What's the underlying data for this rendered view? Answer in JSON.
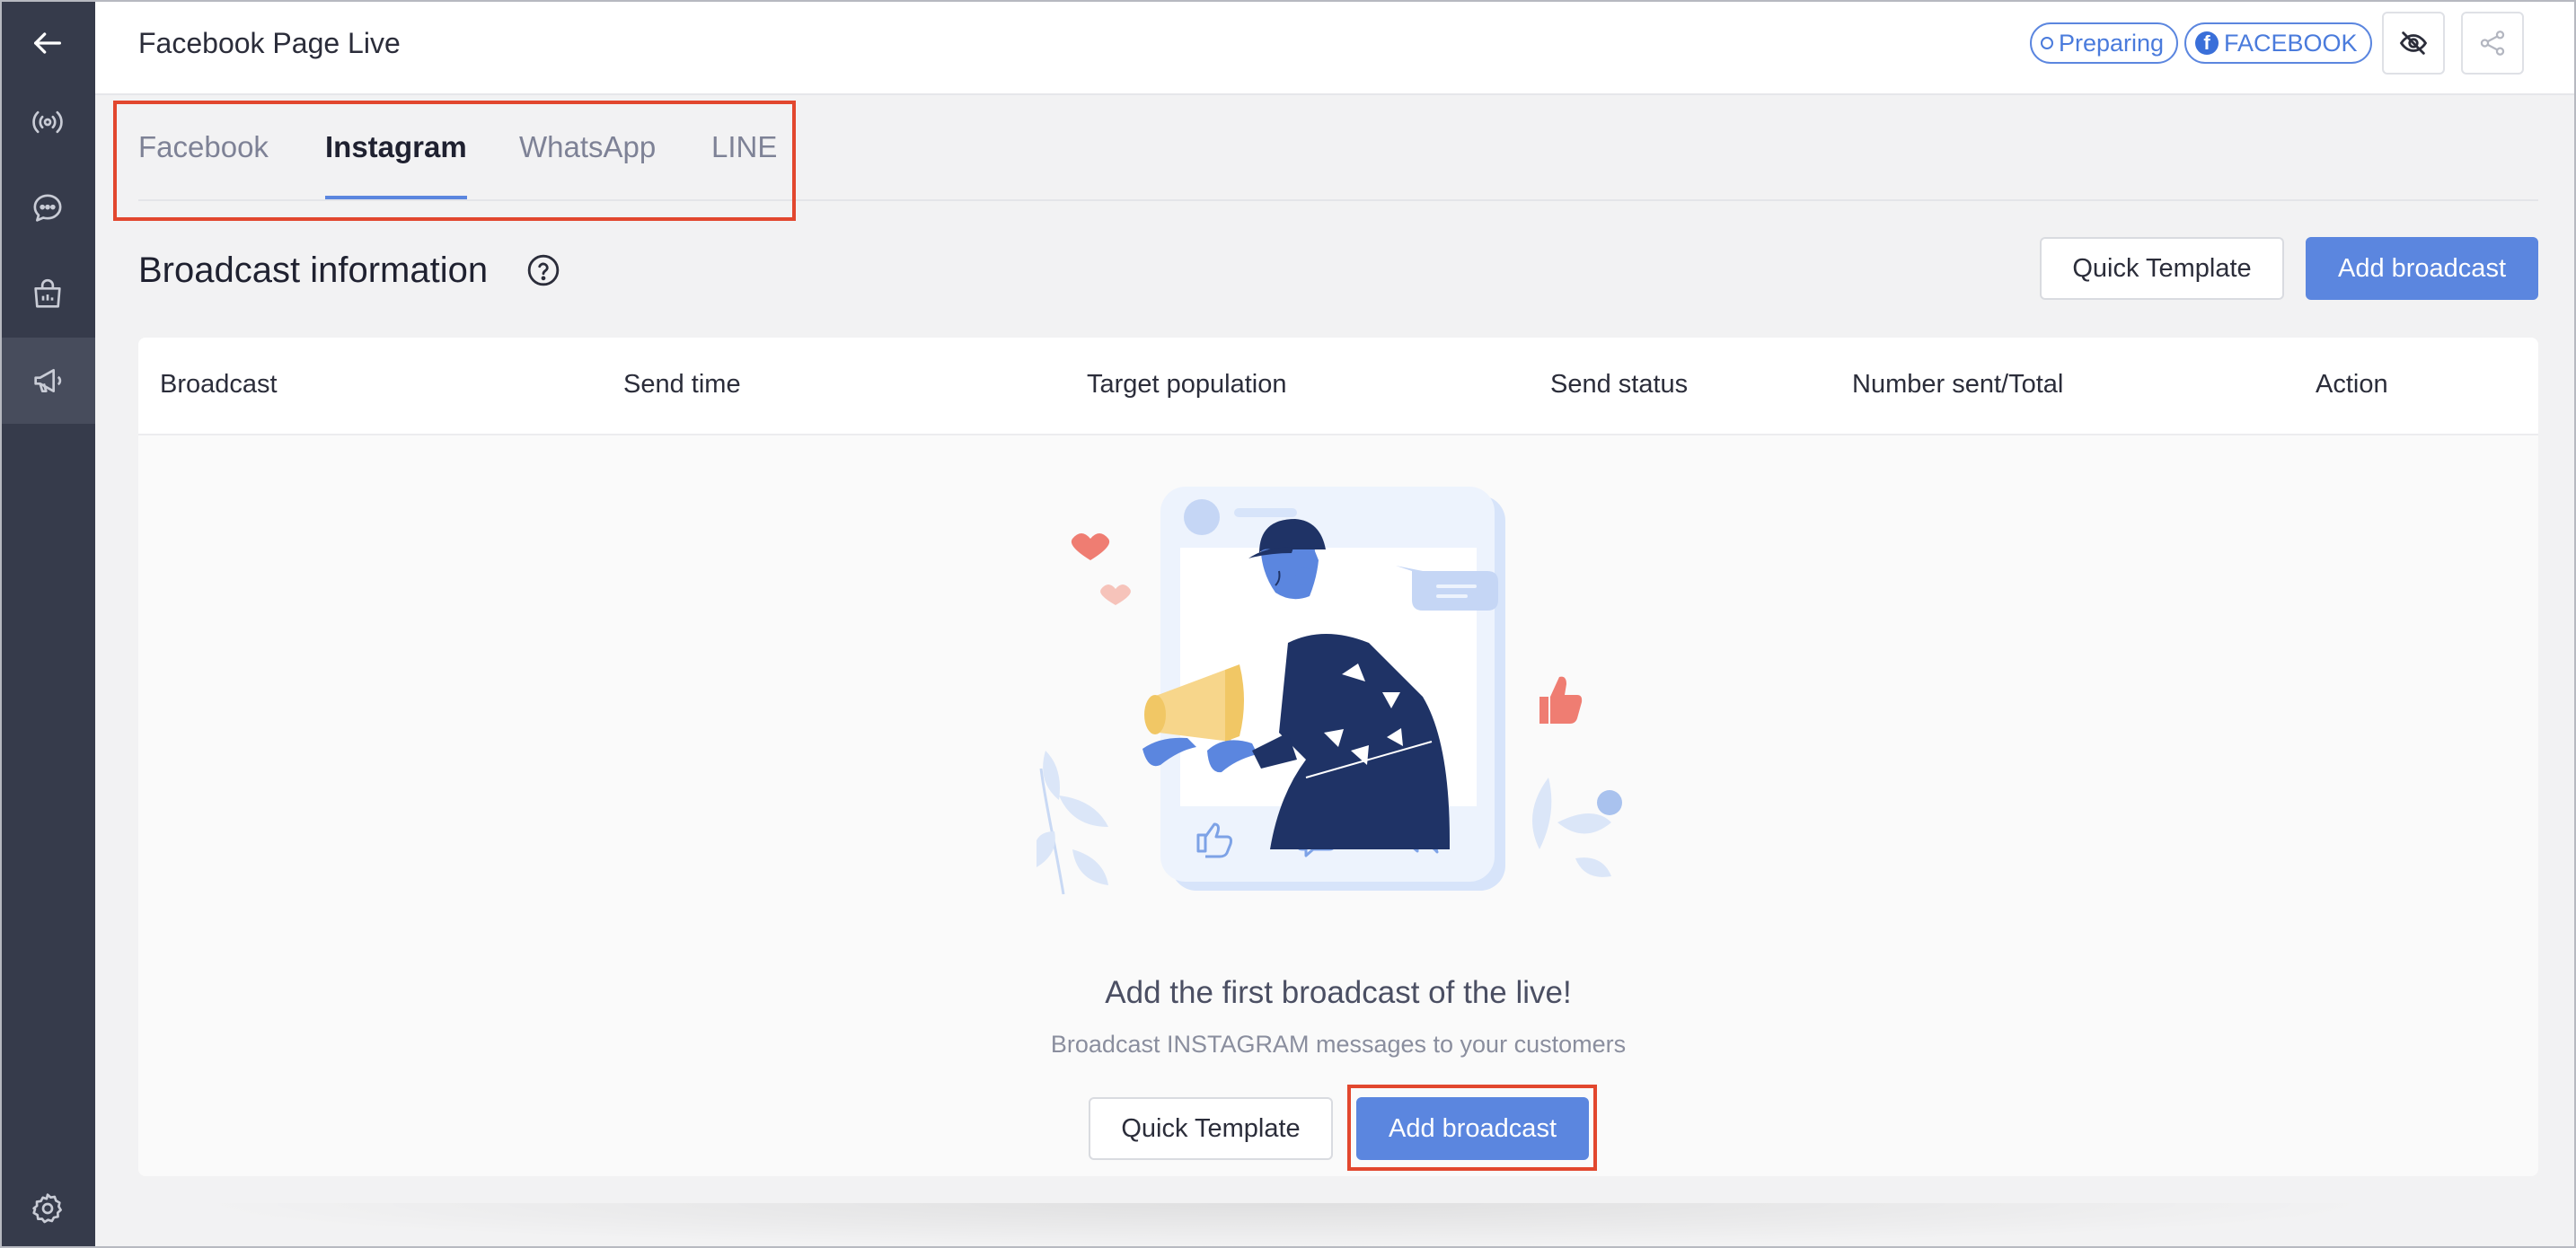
{
  "header": {
    "title": "Facebook Page Live",
    "status_badge": "Preparing",
    "platform_badge": "FACEBOOK"
  },
  "tabs": [
    {
      "label": "Facebook",
      "active": false
    },
    {
      "label": "Instagram",
      "active": true
    },
    {
      "label": "WhatsApp",
      "active": false
    },
    {
      "label": "LINE",
      "active": false
    }
  ],
  "section": {
    "title": "Broadcast information",
    "quick_template_label": "Quick Template",
    "add_broadcast_label": "Add broadcast"
  },
  "table": {
    "columns": [
      "Broadcast",
      "Send time",
      "Target population",
      "Send status",
      "Number sent/Total",
      "Action"
    ]
  },
  "empty_state": {
    "title": "Add the first broadcast of the live!",
    "subtitle": "Broadcast INSTAGRAM messages to your customers",
    "quick_template_label": "Quick Template",
    "add_broadcast_label": "Add broadcast"
  },
  "colors": {
    "sidebar_bg": "#363b4b",
    "accent": "#5b86df",
    "highlight": "#e2472e"
  },
  "icons": {
    "sidebar": [
      "back-arrow-icon",
      "live-broadcast-icon",
      "chat-bubble-icon",
      "shopping-bag-icon",
      "megaphone-icon",
      "settings-gear-icon"
    ],
    "header": [
      "eye-off-icon",
      "share-icon"
    ]
  }
}
